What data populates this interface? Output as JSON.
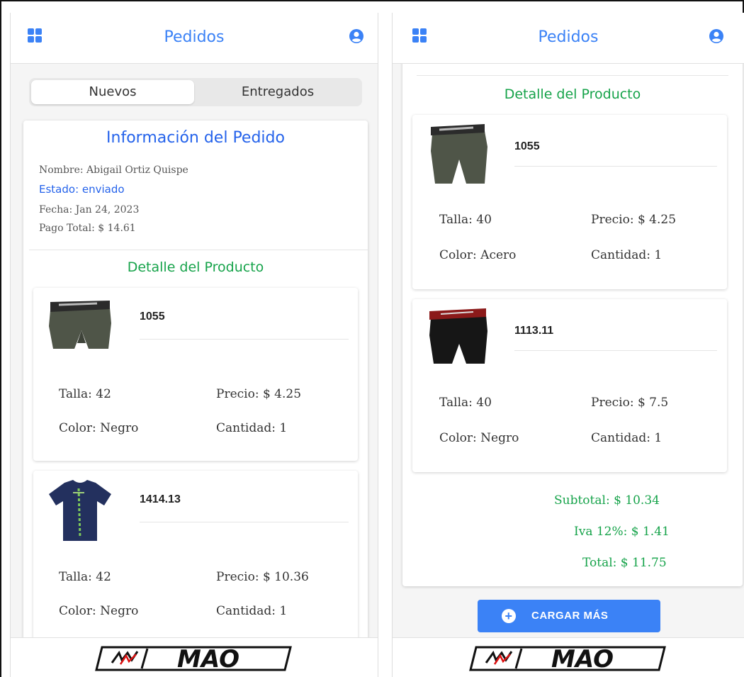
{
  "app": {
    "title": "Pedidos"
  },
  "tabs": {
    "nuevos": "Nuevos",
    "entregados": "Entregados"
  },
  "order": {
    "heading": "Información del Pedido",
    "nombre": "Nombre: Abigail Ortiz Quispe",
    "estado": "Estado: enviado",
    "fecha": "Fecha: Jan 24, 2023",
    "pago": "Pago Total: $ 14.61"
  },
  "detail_heading": "Detalle del Producto",
  "left_products": [
    {
      "code": "1055",
      "talla": "Talla: 42",
      "precio": "Precio: $ 4.25",
      "color": "Color: Negro",
      "cantidad": "Cantidad: 1",
      "image": "boxer-gray"
    },
    {
      "code": "1414.13",
      "talla": "Talla: 42",
      "precio": "Precio: $ 10.36",
      "color": "Color: Negro",
      "cantidad": "Cantidad: 1",
      "image": "tshirt-navy"
    }
  ],
  "right_products": [
    {
      "code": "1055",
      "talla": "Talla: 40",
      "precio": "Precio: $ 4.25",
      "color": "Color: Acero",
      "cantidad": "Cantidad: 1",
      "image": "boxer-gray"
    },
    {
      "code": "1113.11",
      "talla": "Talla: 40",
      "precio": "Precio: $ 7.5",
      "color": "Color: Negro",
      "cantidad": "Cantidad: 1",
      "image": "boxer-black"
    }
  ],
  "totals": {
    "subtotal": "Subtotal: $  10.34",
    "iva": "Iva 12%: $  1.41",
    "total": "Total: $  11.75"
  },
  "load_more": "CARGAR MÁS",
  "logo_text": "MAO",
  "colors": {
    "primary": "#3b82f6",
    "heading_blue": "#2563eb",
    "green": "#16a34a"
  },
  "icons": {
    "menu": "grid-icon",
    "account": "user-circle-icon",
    "add": "plus-circle-icon"
  }
}
